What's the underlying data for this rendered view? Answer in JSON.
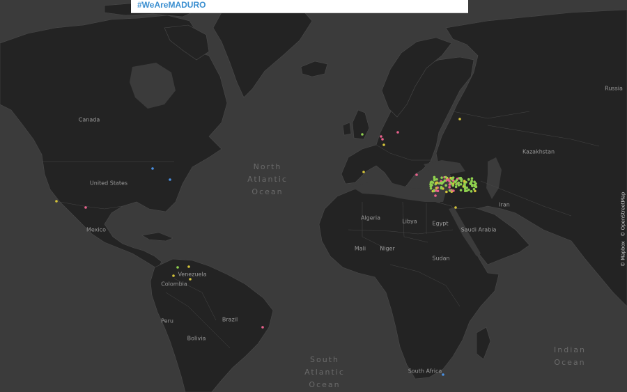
{
  "hashtag": "#WeAreMADURO",
  "attribution": {
    "mapbox": "© Mapbox",
    "osm": "© OpenStreetMap"
  },
  "colors": {
    "water": "#3b3b3b",
    "land": "#232323",
    "dot_green": "#8fd14f",
    "dot_pink": "#e8618c",
    "dot_blue": "#4a90e2",
    "dot_yellow": "#d4c33a"
  },
  "countries": {
    "canada": "Canada",
    "united_states": "United States",
    "mexico": "Mexico",
    "venezuela": "Venezuela",
    "colombia": "Colombia",
    "peru": "Peru",
    "brazil": "Brazil",
    "bolivia": "Bolivia",
    "algeria": "Algeria",
    "libya": "Libya",
    "egypt": "Egypt",
    "mali": "Mali",
    "niger": "Niger",
    "sudan": "Sudan",
    "south_africa": "South Africa",
    "saudi_arabia": "Saudi Arabia",
    "iran": "Iran",
    "kazakhstan": "Kazakhstan",
    "russia": "Russia"
  },
  "oceans": {
    "north_atlantic": [
      "North",
      "Atlantic",
      "Ocean"
    ],
    "south_atlantic": [
      "South",
      "Atlantic",
      "Ocean"
    ],
    "indian": [
      "Indian",
      "Ocean"
    ]
  }
}
